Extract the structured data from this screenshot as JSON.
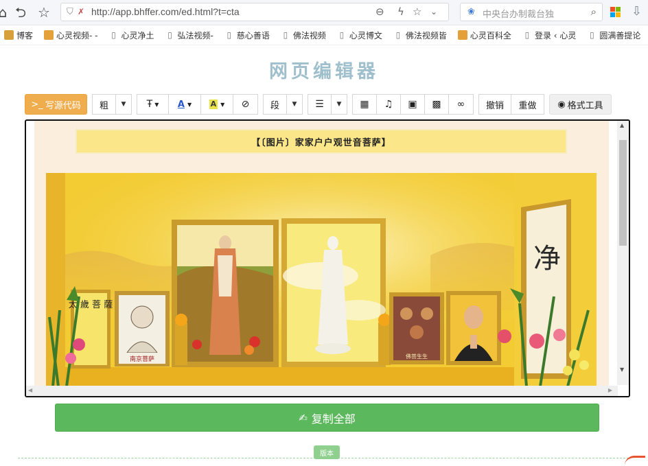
{
  "browser": {
    "url": "http://app.bhffer.com/ed.html?t=cta",
    "search_placeholder": "中央台办制裁台独",
    "bookmarks": [
      {
        "label": "博客",
        "icon": "folder-icon"
      },
      {
        "label": "心灵视频- -",
        "icon": "site-icon"
      },
      {
        "label": "心灵净土",
        "icon": "page-icon"
      },
      {
        "label": "弘法视频-",
        "icon": "page-icon"
      },
      {
        "label": "慈心善语",
        "icon": "page-icon"
      },
      {
        "label": "佛法视频",
        "icon": "page-icon"
      },
      {
        "label": "心灵博文",
        "icon": "page-icon"
      },
      {
        "label": "佛法视频皆",
        "icon": "page-icon"
      },
      {
        "label": "心灵百科全",
        "icon": "site-icon"
      },
      {
        "label": "登录 ‹ 心灵",
        "icon": "page-icon"
      },
      {
        "label": "圆满善提论",
        "icon": "page-icon"
      }
    ]
  },
  "page": {
    "title": "网页编辑器"
  },
  "toolbar": {
    "source_label": "写源代码",
    "bold_label": "粗",
    "paragraph_label": "段",
    "undo_label": "撤销",
    "redo_label": "重做",
    "format_label": "格式工具"
  },
  "editor": {
    "caption": "【〔图片〕家家户户观世音菩萨】",
    "photo": {
      "left_scroll_chars": "太 歲 菩 薩",
      "left_portrait_label": "南京菩萨",
      "right_scroll_char": "净",
      "small_painting_label": "佛菩生生"
    }
  },
  "actions": {
    "copy_all_label": "复制全部"
  },
  "footer": {
    "version_label": "版本"
  }
}
